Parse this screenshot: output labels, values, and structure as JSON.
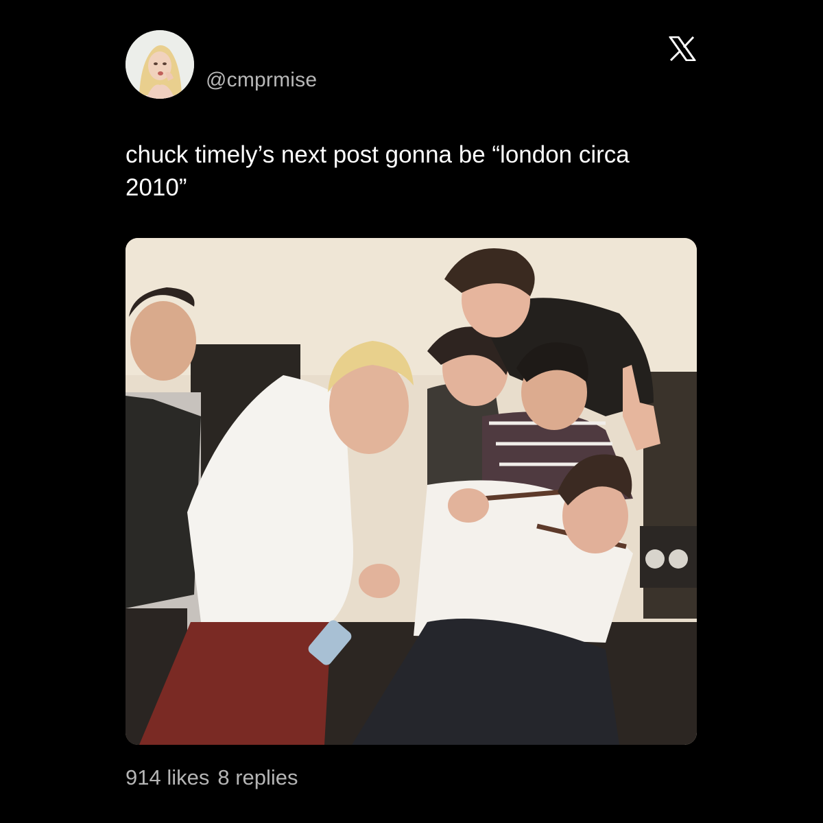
{
  "post": {
    "avatar_icon": "profile-photo-avatar",
    "handle": "@cmprmise",
    "platform_icon": "x-logo-icon",
    "text": "chuck timely’s next post gonna be “london circa 2010”",
    "photo_icon": "group-photo-image",
    "likes_label": "914 likes",
    "replies_label": "8 replies"
  },
  "colors": {
    "background": "#000000",
    "text": "#ffffff",
    "muted_text": "#b5b5b5"
  }
}
